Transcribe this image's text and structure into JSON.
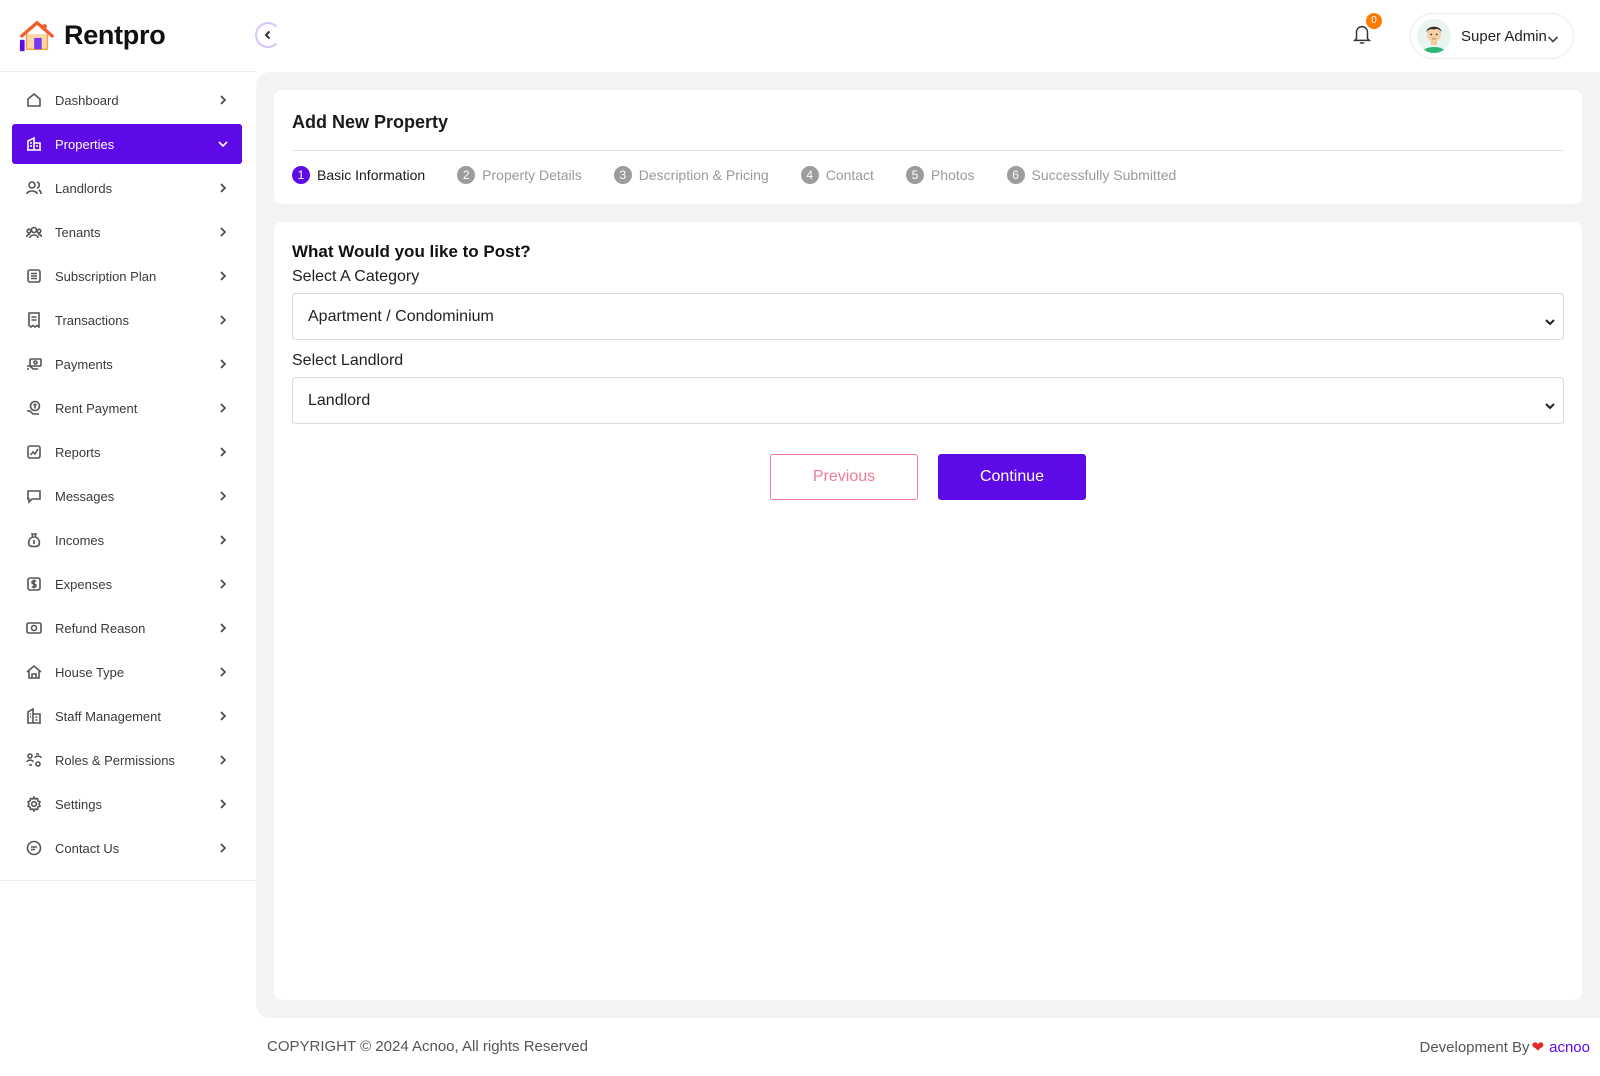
{
  "brand": {
    "name": "Rentpro"
  },
  "sidebar": {
    "items": [
      {
        "label": "Dashboard",
        "icon": "home-icon",
        "active": false
      },
      {
        "label": "Properties",
        "icon": "building-icon",
        "active": true
      },
      {
        "label": "Landlords",
        "icon": "users-icon",
        "active": false
      },
      {
        "label": "Tenants",
        "icon": "group-icon",
        "active": false
      },
      {
        "label": "Subscription Plan",
        "icon": "list-icon",
        "active": false
      },
      {
        "label": "Transactions",
        "icon": "receipt-icon",
        "active": false
      },
      {
        "label": "Payments",
        "icon": "payment-icon",
        "active": false
      },
      {
        "label": "Rent Payment",
        "icon": "coin-hand-icon",
        "active": false
      },
      {
        "label": "Reports",
        "icon": "report-icon",
        "active": false
      },
      {
        "label": "Messages",
        "icon": "message-icon",
        "active": false
      },
      {
        "label": "Incomes",
        "icon": "money-bag-icon",
        "active": false
      },
      {
        "label": "Expenses",
        "icon": "expense-icon",
        "active": false
      },
      {
        "label": "Refund Reason",
        "icon": "refund-icon",
        "active": false
      },
      {
        "label": "House Type",
        "icon": "house-type-icon",
        "active": false
      },
      {
        "label": "Staff Management",
        "icon": "staff-icon",
        "active": false
      },
      {
        "label": "Roles & Permissions",
        "icon": "roles-icon",
        "active": false
      },
      {
        "label": "Settings",
        "icon": "gear-icon",
        "active": false
      },
      {
        "label": "Contact Us",
        "icon": "chat-icon",
        "active": false
      }
    ]
  },
  "topbar": {
    "notification_count": "0",
    "user_name": "Super Admin"
  },
  "header_card": {
    "title": "Add New Property",
    "steps": [
      {
        "num": "1",
        "label": "Basic Information",
        "active": true
      },
      {
        "num": "2",
        "label": "Property Details",
        "active": false
      },
      {
        "num": "3",
        "label": "Description & Pricing",
        "active": false
      },
      {
        "num": "4",
        "label": "Contact",
        "active": false
      },
      {
        "num": "5",
        "label": "Photos",
        "active": false
      },
      {
        "num": "6",
        "label": "Successfully Submitted",
        "active": false
      }
    ]
  },
  "form": {
    "heading": "What Would you like to Post?",
    "category_label": "Select A Category",
    "category_value": "Apartment / Condominium",
    "landlord_label": "Select Landlord",
    "landlord_value": "Landlord",
    "previous_label": "Previous",
    "continue_label": "Continue"
  },
  "footer": {
    "copyright": "COPYRIGHT © 2024 Acnoo, All rights Reserved",
    "dev_prefix": "Development By",
    "dev_brand": "acnoo"
  },
  "colors": {
    "accent": "#5e0ae6",
    "previous": "#f07a95",
    "badge": "#ff7a00"
  }
}
